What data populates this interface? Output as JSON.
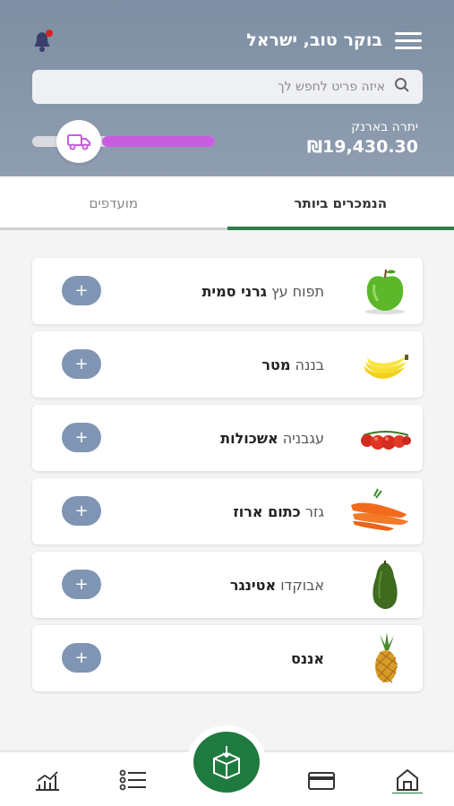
{
  "header": {
    "greeting": "בוקר טוב, ישראל",
    "search_placeholder": "איזה פריט לחפש לך",
    "balance_label": "יתרה בארנק",
    "balance_value": "₪19,430.30",
    "progress_fraction": 0.62
  },
  "tabs": [
    {
      "label": "הנמכרים ביותר",
      "active": true
    },
    {
      "label": "מועדפים",
      "active": false
    }
  ],
  "products": [
    {
      "base": "תפוח עץ",
      "variety": "גרני סמית",
      "image": "green-apple"
    },
    {
      "base": "בננה",
      "variety": "מטר",
      "image": "banana"
    },
    {
      "base": "עגבניה",
      "variety": "אשכולות",
      "image": "tomato-cluster"
    },
    {
      "base": "גזר",
      "variety": "כתום ארוז",
      "image": "carrot"
    },
    {
      "base": "אבוקדו",
      "variety": "אטינגר",
      "image": "avocado"
    },
    {
      "base": "אננס",
      "variety": "",
      "image": "pineapple"
    }
  ],
  "add_label": "+",
  "nav": [
    "home-icon",
    "card-icon",
    "box-download-icon",
    "list-icon",
    "chart-icon"
  ],
  "colors": {
    "accent_green": "#1f7a3f",
    "progress_purple": "#c85de0",
    "header_gray": "#8695a8"
  }
}
